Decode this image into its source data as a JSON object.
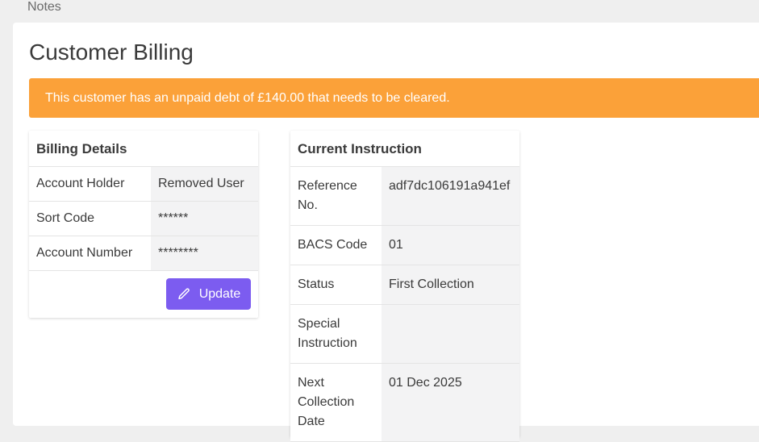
{
  "nav": {
    "notes_label": "Notes"
  },
  "page": {
    "title": "Customer Billing"
  },
  "alert": {
    "message": "This customer has an unpaid debt of £140.00 that needs to be cleared.",
    "color": "#fba139"
  },
  "billing": {
    "header": "Billing Details",
    "rows": [
      {
        "label": "Account Holder",
        "value": "Removed User"
      },
      {
        "label": "Sort Code",
        "value": "******"
      },
      {
        "label": "Account Number",
        "value": "********"
      }
    ],
    "update_label": "Update",
    "update_icon": "pencil-icon",
    "accent": "#7c5cf0"
  },
  "instruction": {
    "header": "Current Instruction",
    "rows": [
      {
        "label": "Reference No.",
        "value": "adf7dc106191a941ef"
      },
      {
        "label": "BACS Code",
        "value": "01"
      },
      {
        "label": "Status",
        "value": "First Collection"
      },
      {
        "label": "Special Instruction",
        "value": ""
      },
      {
        "label": "Next Collection Date",
        "value": "01 Dec 2025"
      }
    ]
  }
}
